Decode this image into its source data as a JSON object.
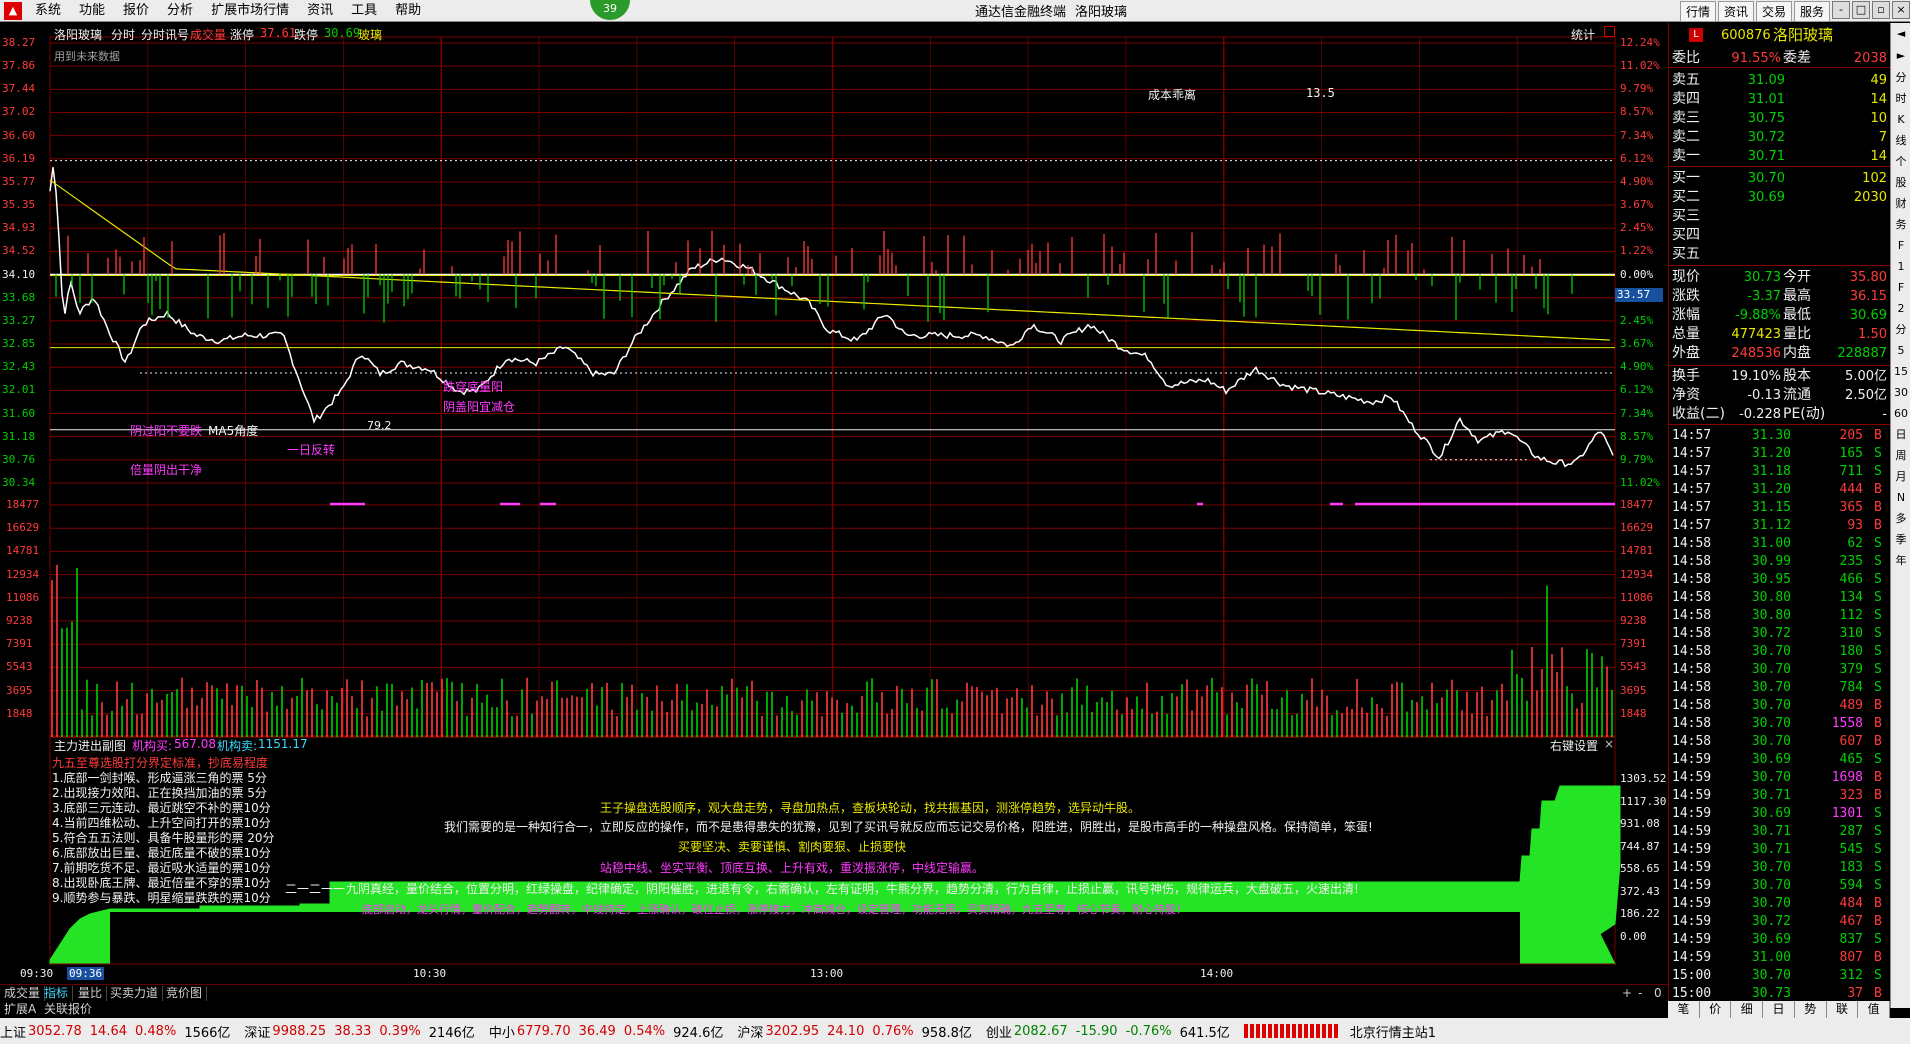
{
  "menubar": {
    "items": [
      "系统",
      "功能",
      "报价",
      "分析",
      "扩展市场行情",
      "资讯",
      "工具",
      "帮助"
    ],
    "badge": "39",
    "app_title": "通达信金融终端",
    "stock_title": "洛阳玻璃",
    "right_buttons": [
      "行情",
      "资讯",
      "交易",
      "服务"
    ],
    "window_buttons": [
      "-",
      "□",
      "▫",
      "×"
    ]
  },
  "chart_header": {
    "name": "洛阳玻璃",
    "tabs": [
      "分时",
      "分时讯号"
    ],
    "vol_label": "成交量",
    "limit_up_label": "涨停",
    "limit_up": "37.61",
    "limit_down_label": "跌停",
    "limit_down": "30.69",
    "sector": "玻璃",
    "stat_label": "统计",
    "sub_note": "用到未来数据",
    "cost_label": "成本乖离",
    "cost_value": "13.5"
  },
  "price_axis": {
    "left_labels": [
      "38.27",
      "37.86",
      "37.44",
      "37.02",
      "36.60",
      "36.19",
      "35.77",
      "35.35",
      "34.93",
      "34.52",
      "34.10",
      "33.68",
      "33.27",
      "32.85",
      "32.43",
      "32.01",
      "31.60",
      "31.18",
      "30.76",
      "30.34"
    ],
    "right_labels": [
      "12.24%",
      "11.02%",
      "9.79%",
      "8.57%",
      "7.34%",
      "6.12%",
      "4.90%",
      "3.67%",
      "2.45%",
      "1.22%",
      "0.00%",
      "1.22%",
      "2.45%",
      "3.67%",
      "4.90%",
      "6.12%",
      "7.34%",
      "8.57%",
      "9.79%",
      "11.02%"
    ],
    "current_marker": "33.57"
  },
  "volume_axis": {
    "labels": [
      "18477",
      "16629",
      "14781",
      "12934",
      "11086",
      "9238",
      "7391",
      "5543",
      "3695",
      "1848"
    ]
  },
  "annotations": {
    "a1": "阴过阳不要跌",
    "a2": "MA5角度",
    "a3": "一日反转",
    "a4": "倍量阴出干净",
    "a5": "跌穿底量阳",
    "a6": "阴盖阳宜减仓",
    "a7": "79.2"
  },
  "indicator": {
    "title": "主力进出副图",
    "buy_label": "机构买:",
    "buy_value": "567.08",
    "sell_label": "机构卖:",
    "sell_value": "1151.17",
    "setting": "右键设置",
    "heading": "九五至尊选股打分界定标准，抄底易程度",
    "rules": [
      "1.底部一剑封喉、形成逼涨三角的票 5分",
      "2.出现接力效阳、正在换挡加油的票 5分",
      "3.底部三元连动、最近跳空不补的票10分",
      "4.当前四维松动、上升空间打开的票10分",
      "5.符合五五法则、具备牛股量形的票 20分",
      "6.底部放出巨量、最近底量不破的票10分",
      "7.前期吃货不足、最近吸水适量的票10分",
      "8.出现卧底王牌、最近倍量不穿的票10分",
      "9.顺势参与暴跌、明星缩量跌跌的票10分"
    ],
    "axis": [
      "1303.52",
      "1117.30",
      "931.08",
      "744.87",
      "558.65",
      "372.43",
      "186.22",
      "0.00"
    ],
    "msg1": "王子操盘选股顺序，观大盘走势，寻盘加热点，查板块轮动，找共振基因，测涨停趋势，选异动牛股。",
    "msg2": "我们需要的是一种知行合一，立即反应的操作，而不是患得患失的犹豫，见到了买讯号就反应而忘记交易价格，阳胜进，阴胜出，是股市高手的一种操盘风格。保持简单，笨蛋!",
    "msg3": "买要坚决、卖要谨慎、割肉要狠、止损要快",
    "msg4": "站稳中线、坐实平衡、顶底互换、上升有戏，重泼振涨停，中线定输赢。",
    "msg5": "九阴真经，量价结合，位置分明，红绿操盘，纪律确定，阴阳催胜，进退有令，右需确认，左有证明，牛熊分界，趋势分清，行为自律，止损止赢，讯号神伤，规律运兵，大盘破五，火速出清!",
    "msg6": "底部启动，龙头行情，量价配合，趋势翻转，中线持定，上涨确认，破位止损，涨停接力，冲高减仓，设定管理，功能无限，买卖精确，九五至尊，核心节奏，耐心持股！",
    "dashes": "二一二一一"
  },
  "time_axis": [
    "09:30",
    "09:36",
    "10:30",
    "13:00",
    "14:00"
  ],
  "bottom_tabs1": [
    "成交量",
    "指标",
    "量比",
    "买卖力道",
    "竞价图"
  ],
  "bottom_tabs2": [
    "扩展A",
    "关联报价"
  ],
  "rp_header": {
    "code": "600876",
    "name": "洛阳玻璃",
    "flag": "L"
  },
  "rp_commission": {
    "ratio_label": "委比",
    "ratio": "91.55%",
    "diff_label": "委差",
    "diff": "2038"
  },
  "asks": [
    {
      "label": "卖五",
      "price": "31.09",
      "vol": "49"
    },
    {
      "label": "卖四",
      "price": "31.01",
      "vol": "14"
    },
    {
      "label": "卖三",
      "price": "30.75",
      "vol": "10"
    },
    {
      "label": "卖二",
      "price": "30.72",
      "vol": "7"
    },
    {
      "label": "卖一",
      "price": "30.71",
      "vol": "14"
    }
  ],
  "bids": [
    {
      "label": "买一",
      "price": "30.70",
      "vol": "102"
    },
    {
      "label": "买二",
      "price": "30.69",
      "vol": "2030"
    },
    {
      "label": "买三",
      "price": "",
      "vol": ""
    },
    {
      "label": "买四",
      "price": "",
      "vol": ""
    },
    {
      "label": "买五",
      "price": "",
      "vol": ""
    }
  ],
  "quote": [
    {
      "l1": "现价",
      "v1": "30.73",
      "l2": "今开",
      "v2": "35.80"
    },
    {
      "l1": "涨跌",
      "v1": "-3.37",
      "l2": "最高",
      "v2": "36.15"
    },
    {
      "l1": "涨幅",
      "v1": "-9.88%",
      "l2": "最低",
      "v2": "30.69"
    },
    {
      "l1": "总量",
      "v1": "477423",
      "l2": "量比",
      "v2": "1.50"
    },
    {
      "l1": "外盘",
      "v1": "248536",
      "l2": "内盘",
      "v2": "228887"
    }
  ],
  "quote2": [
    {
      "l1": "换手",
      "v1": "19.10%",
      "l2": "股本",
      "v2": "5.00亿"
    },
    {
      "l1": "净资",
      "v1": "-0.13",
      "l2": "流通",
      "v2": "2.50亿"
    },
    {
      "l1": "收益(二)",
      "v1": "-0.228",
      "l2": "PE(动)",
      "v2": "-"
    }
  ],
  "ticks": [
    [
      "14:57",
      "31.30",
      "205",
      "B"
    ],
    [
      "14:57",
      "31.20",
      "165",
      "S"
    ],
    [
      "14:57",
      "31.18",
      "711",
      "S"
    ],
    [
      "14:57",
      "31.20",
      "444",
      "B"
    ],
    [
      "14:57",
      "31.15",
      "365",
      "B"
    ],
    [
      "14:57",
      "31.12",
      "93",
      "B"
    ],
    [
      "14:58",
      "31.00",
      "62",
      "S"
    ],
    [
      "14:58",
      "30.99",
      "235",
      "S"
    ],
    [
      "14:58",
      "30.95",
      "466",
      "S"
    ],
    [
      "14:58",
      "30.80",
      "134",
      "S"
    ],
    [
      "14:58",
      "30.80",
      "112",
      "S"
    ],
    [
      "14:58",
      "30.72",
      "310",
      "S"
    ],
    [
      "14:58",
      "30.70",
      "180",
      "S"
    ],
    [
      "14:58",
      "30.70",
      "379",
      "S"
    ],
    [
      "14:58",
      "30.70",
      "784",
      "S"
    ],
    [
      "14:58",
      "30.70",
      "489",
      "B"
    ],
    [
      "14:58",
      "30.70",
      "1558",
      "B"
    ],
    [
      "14:58",
      "30.70",
      "607",
      "B"
    ],
    [
      "14:59",
      "30.69",
      "465",
      "S"
    ],
    [
      "14:59",
      "30.70",
      "1698",
      "B"
    ],
    [
      "14:59",
      "30.71",
      "323",
      "B"
    ],
    [
      "14:59",
      "30.69",
      "1301",
      "S"
    ],
    [
      "14:59",
      "30.71",
      "287",
      "S"
    ],
    [
      "14:59",
      "30.71",
      "545",
      "S"
    ],
    [
      "14:59",
      "30.70",
      "183",
      "S"
    ],
    [
      "14:59",
      "30.70",
      "594",
      "S"
    ],
    [
      "14:59",
      "30.70",
      "484",
      "B"
    ],
    [
      "14:59",
      "30.72",
      "467",
      "B"
    ],
    [
      "14:59",
      "30.69",
      "837",
      "S"
    ],
    [
      "14:59",
      "31.00",
      "807",
      "B"
    ],
    [
      "15:00",
      "30.70",
      "312",
      "S"
    ],
    [
      "15:00",
      "30.73",
      "37",
      "B"
    ]
  ],
  "rp_bottom_tabs": [
    "笔",
    "价",
    "细",
    "日",
    "势",
    "联",
    "值"
  ],
  "sidebar": [
    "◄",
    "►",
    "分",
    "时",
    "K",
    "线",
    "个",
    "股",
    "财",
    "务",
    "F",
    "1",
    "F",
    "2",
    "分",
    "5",
    "15",
    "30",
    "60",
    "日",
    "周",
    "月",
    "N",
    "多",
    "季",
    "年"
  ],
  "statusbar": [
    {
      "name": "上证",
      "val": "3052.78",
      "chg": "14.64",
      "pct": "0.48%",
      "amt": "1566亿"
    },
    {
      "name": "深证",
      "val": "9988.25",
      "chg": "38.33",
      "pct": "0.39%",
      "amt": "2146亿"
    },
    {
      "name": "中小",
      "val": "6779.70",
      "chg": "36.49",
      "pct": "0.54%",
      "amt": "924.6亿"
    },
    {
      "name": "沪深",
      "val": "3202.95",
      "chg": "24.10",
      "pct": "0.76%",
      "amt": "958.8亿"
    },
    {
      "name": "创业",
      "val": "2082.67",
      "chg": "-15.90",
      "pct": "-0.76%",
      "amt": "641.5亿"
    }
  ],
  "station": "北京行情主站1",
  "colors": {
    "up": "#ff3b3b",
    "down": "#00d000",
    "price_line": "#ffffff",
    "avg_line": "#e8e800",
    "grid": "#7a0000"
  }
}
